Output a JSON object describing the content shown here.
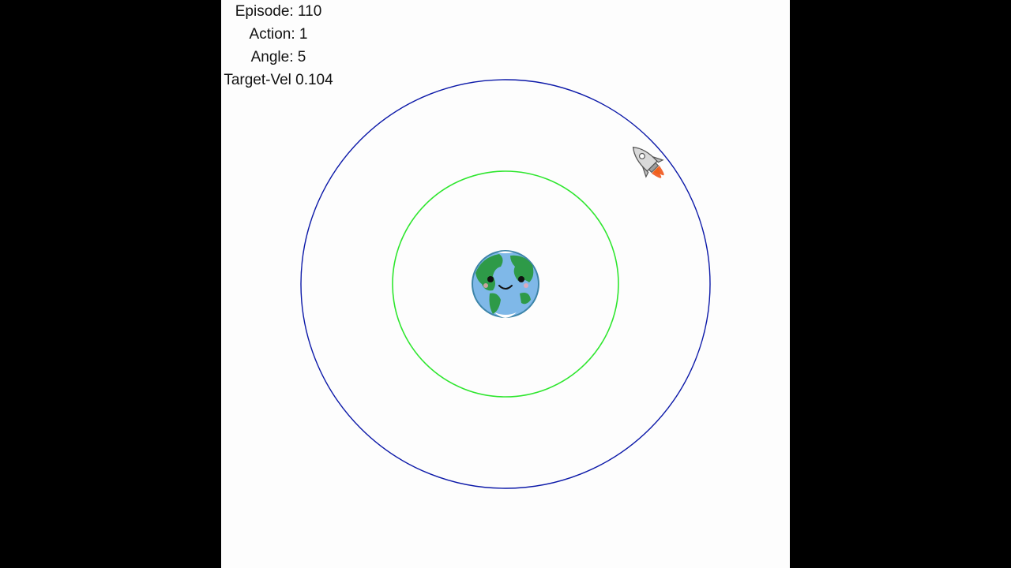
{
  "hud": {
    "episode_label": "Episode:",
    "episode_value": "110",
    "action_label": "Action:",
    "action_value": "1",
    "angle_label": "Angle:",
    "angle_value": "5",
    "target_vel_label": "Target-Vel",
    "target_vel_value": "0.104"
  },
  "scene": {
    "background_color": "#fdfdfd",
    "letterbox_color": "#000000",
    "target_orbit_color": "#0b18a8",
    "current_orbit_color": "#2ee62e",
    "planet_icon": "earth-icon",
    "ship_icon": "rocket-icon"
  }
}
